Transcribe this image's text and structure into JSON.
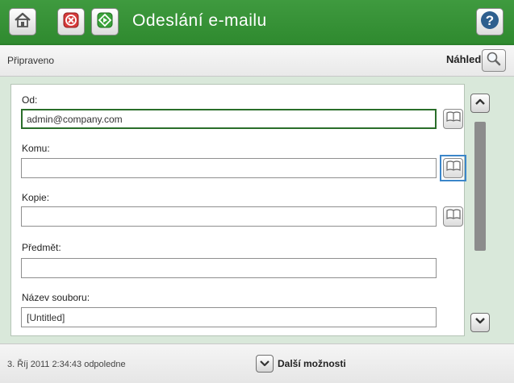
{
  "header": {
    "title": "Odeslání e-mailu",
    "home_icon": "home-icon",
    "stop_icon": "stop-icon",
    "start_icon": "start-icon",
    "help_icon": "help-icon",
    "accent_color": "#3a943a"
  },
  "status_bar": {
    "status": "Připraveno",
    "preview_label": "Náhled",
    "preview_icon": "magnifier-icon"
  },
  "form": {
    "fields": [
      {
        "label": "Od:",
        "value": "admin@company.com",
        "address_book": true,
        "active": true
      },
      {
        "label": "Komu:",
        "value": "",
        "address_book": true,
        "focused_book": true
      },
      {
        "label": "Kopie:",
        "value": "",
        "address_book": true
      },
      {
        "label": "Předmět:",
        "value": "",
        "address_book": false
      },
      {
        "label": "Název souboru:",
        "value": "[Untitled]",
        "address_book": false
      }
    ],
    "address_book_icon": "address-book-icon"
  },
  "scrollbar": {
    "up_icon": "chevron-up-icon",
    "down_icon": "chevron-down-icon"
  },
  "footer": {
    "datetime": "3. Říj 2011 2:34:43 odpoledne",
    "more_options_label": "Další možnosti",
    "more_options_icon": "chevron-down-icon"
  }
}
